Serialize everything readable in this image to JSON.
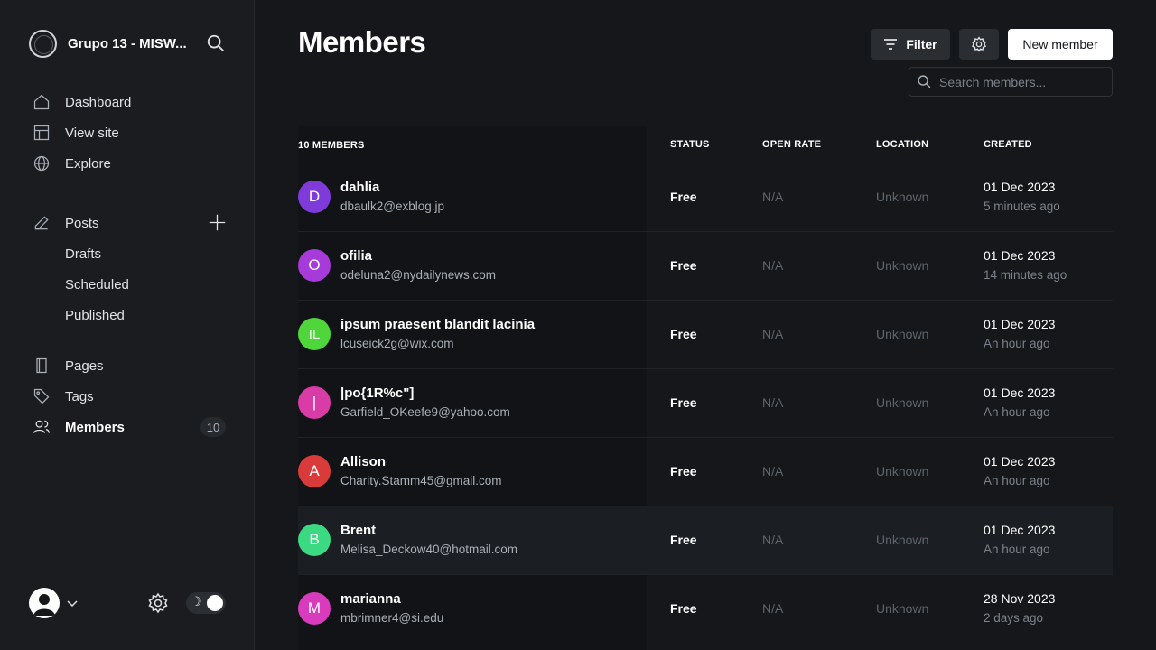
{
  "sidebar": {
    "brand": "Grupo 13 - MISW...",
    "nav": [
      "Dashboard",
      "View site",
      "Explore"
    ],
    "posts": "Posts",
    "post_sub": [
      "Drafts",
      "Scheduled",
      "Published"
    ],
    "pages": "Pages",
    "tags": "Tags",
    "members": "Members",
    "members_count": "10"
  },
  "header": {
    "title": "Members",
    "filter": "Filter",
    "new_member": "New member",
    "search_placeholder": "Search members..."
  },
  "table": {
    "headers": [
      "10 MEMBERS",
      "STATUS",
      "OPEN RATE",
      "LOCATION",
      "CREATED"
    ],
    "rows": [
      {
        "initial": "D",
        "color": "#7f3bd9",
        "name": "dahlia",
        "email": "dbaulk2@exblog.jp",
        "status": "Free",
        "open": "N/A",
        "location": "Unknown",
        "date": "01 Dec 2023",
        "ago": "5 minutes ago"
      },
      {
        "initial": "O",
        "color": "#a73bd9",
        "name": "ofilia",
        "email": "odeluna2@nydailynews.com",
        "status": "Free",
        "open": "N/A",
        "location": "Unknown",
        "date": "01 Dec 2023",
        "ago": "14 minutes ago"
      },
      {
        "initial": "IL",
        "color": "#4fd63b",
        "name": "ipsum praesent blandit lacinia",
        "email": "lcuseick2g@wix.com",
        "status": "Free",
        "open": "N/A",
        "location": "Unknown",
        "date": "01 Dec 2023",
        "ago": "An hour ago"
      },
      {
        "initial": "|",
        "color": "#d93ba7",
        "name": "|po{1R%c\"]",
        "email": "Garfield_OKeefe9@yahoo.com",
        "status": "Free",
        "open": "N/A",
        "location": "Unknown",
        "date": "01 Dec 2023",
        "ago": "An hour ago"
      },
      {
        "initial": "A",
        "color": "#d93b3b",
        "name": "Allison",
        "email": "Charity.Stamm45@gmail.com",
        "status": "Free",
        "open": "N/A",
        "location": "Unknown",
        "date": "01 Dec 2023",
        "ago": "An hour ago"
      },
      {
        "initial": "B",
        "color": "#3bd982",
        "name": "Brent",
        "email": "Melisa_Deckow40@hotmail.com",
        "status": "Free",
        "open": "N/A",
        "location": "Unknown",
        "date": "01 Dec 2023",
        "ago": "An hour ago"
      },
      {
        "initial": "M",
        "color": "#d93bbd",
        "name": "marianna",
        "email": "mbrimner4@si.edu",
        "status": "Free",
        "open": "N/A",
        "location": "Unknown",
        "date": "28 Nov 2023",
        "ago": "2 days ago"
      }
    ]
  }
}
